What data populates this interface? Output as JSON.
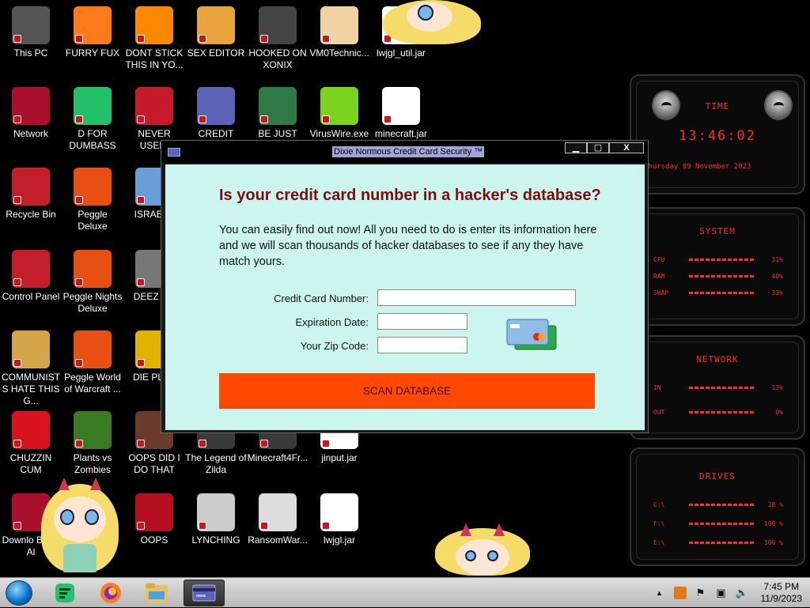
{
  "desktop": {
    "icons": [
      {
        "label": "This PC",
        "icon": "computer-icon",
        "color": "#555"
      },
      {
        "label": "FURRY FUX",
        "icon": "firefox-icon",
        "color": "#ff7a1a"
      },
      {
        "label": "DONT STICK THIS IN YO...",
        "icon": "vlc-icon",
        "color": "#ff8800"
      },
      {
        "label": "SEX EDITOR",
        "icon": "hex-editor-icon",
        "color": "#e9a43b"
      },
      {
        "label": "HOOKED ON XONIX",
        "icon": "xonix-game-icon",
        "color": "#444"
      },
      {
        "label": "VM0Technic...",
        "icon": "doctor-icon",
        "color": "#f1d3a3"
      },
      {
        "label": "lwjgl_util.jar",
        "icon": "java-jar-icon",
        "color": "#fff"
      },
      {
        "label": "Network",
        "icon": "alien-network-icon",
        "color": "#aa0f2b"
      },
      {
        "label": "D FOR DUMBASS",
        "icon": "dumbass-icon",
        "color": "#22c06a"
      },
      {
        "label": "NEVER USED!",
        "icon": "dev-cpp-icon",
        "color": "#c51a2a"
      },
      {
        "label": "CREDIT CARD CHECKER",
        "icon": "credit-card-icon",
        "color": "#5b63b7"
      },
      {
        "label": "BE JUST LIKE THE DUDE!",
        "icon": "elf-icon",
        "color": "#2f7a44"
      },
      {
        "label": "VirusWire.exe",
        "icon": "lime-icon",
        "color": "#7bd320"
      },
      {
        "label": "minecraft.jar",
        "icon": "java-jar-icon",
        "color": "#fff"
      },
      {
        "label": "Recycle Bin",
        "icon": "recycle-bin-icon",
        "color": "#c41e2a"
      },
      {
        "label": "Peggle Deluxe",
        "icon": "peggle-icon",
        "color": "#e94e12"
      },
      {
        "label": "ISRAELS",
        "icon": "tool-icon",
        "color": "#6b9ed6"
      },
      {
        "label": "Control Panel",
        "icon": "control-panel-icon",
        "color": "#c41e2a"
      },
      {
        "label": "Peggle Nights Deluxe",
        "icon": "peggle-icon",
        "color": "#e94e12"
      },
      {
        "label": "DEEZ NU",
        "icon": "window-stack-icon",
        "color": "#777"
      },
      {
        "label": "COMMUNISTS HATE THIS G...",
        "icon": "money-bag-icon",
        "color": "#d3a649"
      },
      {
        "label": "Peggle World of Warcraft ...",
        "icon": "peggle-icon",
        "color": "#e94e12"
      },
      {
        "label": "DIE PLEA",
        "icon": "dictionary-icon",
        "color": "#e2b200"
      },
      {
        "label": "CHUZZIN CUM",
        "icon": "chuzzle-icon",
        "color": "#d9131b"
      },
      {
        "label": "Plants vs Zombies",
        "icon": "pvz-flower-icon",
        "color": "#3a7a23"
      },
      {
        "label": "OOPS DID I DO THAT",
        "icon": "painting-icon",
        "color": "#6b3a2a"
      },
      {
        "label": "The Legend of Zilda",
        "icon": "zelda-icon",
        "color": "#3a3a3a"
      },
      {
        "label": "Minecraft4Fr...",
        "icon": "minecraft-icon",
        "color": "#3a3a3a"
      },
      {
        "label": "jinput.jar",
        "icon": "java-jar-icon",
        "color": "#fff"
      },
      {
        "label": "Downlo Black Al",
        "icon": "alien-download-icon",
        "color": "#aa0f2b"
      },
      {
        "label": "OOPS",
        "icon": "alienware-icon",
        "color": "#b50f20"
      },
      {
        "label": "LYNCHING",
        "icon": "rope-icon",
        "color": "#ccc"
      },
      {
        "label": "RansomWar...",
        "icon": "skull-icon",
        "color": "#ddd"
      },
      {
        "label": "lwjgl.jar",
        "icon": "java-jar-icon",
        "color": "#fff"
      }
    ]
  },
  "dialog": {
    "title": "Dixie Normous Credit Card Security ™",
    "controls": {
      "minimize": "▁",
      "maximize": "▢",
      "close": "X"
    },
    "heading": "Is your credit card number in a hacker's database?",
    "paragraph": "You can easily find out now! All you need to do is enter its information here and we will scan thousands of hacker databases to see if any they have match yours.",
    "fields": {
      "card_label": "Credit Card Number:",
      "card_value": "",
      "exp_label": "Expiration Date:",
      "exp_value": "",
      "zip_label": "Your Zip Code:",
      "zip_value": ""
    },
    "button": "SCAN DATABASE",
    "colors": {
      "client_bg": "#cdf5ef",
      "heading": "#7b0d0d",
      "button": "#ff4800"
    }
  },
  "widgets": {
    "time": {
      "title": "TIME",
      "clock": "13:46:02",
      "date": "Thursday 09 November 2023"
    },
    "system": {
      "title": "SYSTEM",
      "rows": [
        {
          "label": "CPU",
          "value": "31%"
        },
        {
          "label": "RAM",
          "value": "40%"
        },
        {
          "label": "SWAP",
          "value": "33%"
        }
      ]
    },
    "network": {
      "title": "NETWORK",
      "rows": [
        {
          "label": "IN",
          "value": "13%"
        },
        {
          "label": "OUT",
          "value": "0%"
        }
      ]
    },
    "drives": {
      "title": "DRIVES",
      "rows": [
        {
          "label": "C:\\",
          "value": "28 %"
        },
        {
          "label": "F:\\",
          "value": "100 %"
        },
        {
          "label": "E:\\",
          "value": "100 %"
        }
      ]
    },
    "accent": "#ff2a2a"
  },
  "taskbar": {
    "apps": [
      "dumbass-icon",
      "firefox-icon",
      "file-explorer-icon",
      "credit-card-icon"
    ],
    "tray": {
      "up_arrow": "▲",
      "clock_time": "7:45 PM",
      "clock_date": "11/9/2023"
    }
  }
}
